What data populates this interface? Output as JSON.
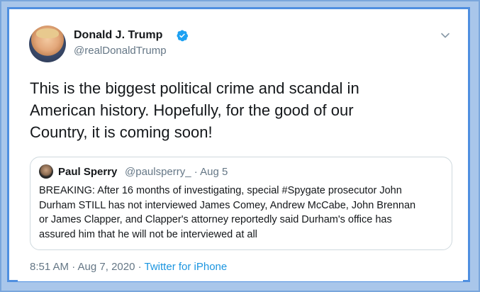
{
  "tweet": {
    "author_name": "Donald J. Trump",
    "author_handle": "@realDonaldTrump",
    "text": "This is the biggest political crime and scandal in\nAmerican history. Hopefully, for the good of our\nCountry, it is coming soon!",
    "timestamp": "8:51 AM · Aug 7, 2020",
    "separator": " · ",
    "source": "Twitter for iPhone"
  },
  "quoted_tweet": {
    "author_name": "Paul Sperry",
    "author_handle": "@paulsperry_",
    "date": "· Aug 5",
    "text": "BREAKING: After 16 months of investigating, special #Spygate prosecutor John\nDurham STILL has not interviewed James Comey, Andrew McCabe, John Brennan\nor James Clapper, and Clapper's attorney reportedly said Durham's office has\nassured him that he will not be interviewed at all"
  },
  "icons": {
    "verified": "verified-badge-icon",
    "menu": "chevron-down-icon"
  },
  "colors": {
    "accent": "#1da1f2",
    "frame_border": "#4f8fe0",
    "frame_outer": "#a9c6ea",
    "text_primary": "#14171a",
    "text_secondary": "#657786",
    "link": "#1b95e0"
  }
}
